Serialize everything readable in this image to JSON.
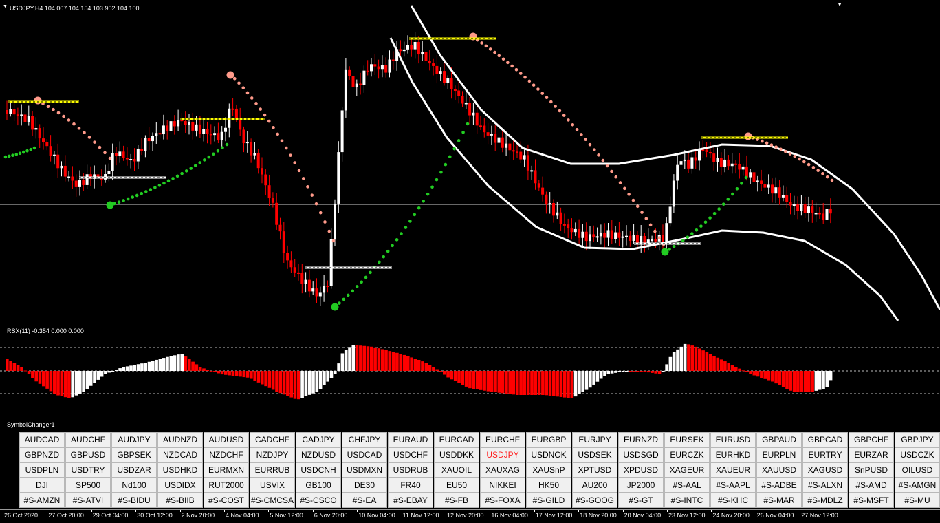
{
  "main": {
    "header": "USDJPY,H4  104.007 104.154 103.902 104.100"
  },
  "oscillator": {
    "header": "RSX(11) -0.354 0.000 0.000"
  },
  "symbol_changer": {
    "title": "SymbolChanger1",
    "active": "USDJPY",
    "rows": [
      [
        "AUDCAD",
        "AUDCHF",
        "AUDJPY",
        "AUDNZD",
        "AUDUSD",
        "CADCHF",
        "CADJPY",
        "CHFJPY",
        "EURAUD",
        "EURCAD",
        "EURCHF",
        "EURGBP",
        "EURJPY",
        "EURNZD",
        "EURSEK",
        "EURUSD",
        "GBPAUD",
        "GBPCAD",
        "GBPCHF",
        "GBPJPY"
      ],
      [
        "GBPNZD",
        "GBPUSD",
        "GBPSEK",
        "NZDCAD",
        "NZDCHF",
        "NZDJPY",
        "NZDUSD",
        "USDCAD",
        "USDCHF",
        "USDDKK",
        "USDJPY",
        "USDNOK",
        "USDSEK",
        "USDSGD",
        "EURCZK",
        "EURHKD",
        "EURPLN",
        "EURTRY",
        "EURZAR",
        "USDCZK"
      ],
      [
        "USDPLN",
        "USDTRY",
        "USDZAR",
        "USDHKD",
        "EURMXN",
        "EURRUB",
        "USDCNH",
        "USDMXN",
        "USDRUB",
        "XAUOIL",
        "XAUXAG",
        "XAUSnP",
        "XPTUSD",
        "XPDUSD",
        "XAGEUR",
        "XAUEUR",
        "XAUUSD",
        "XAGUSD",
        "SnPUSD",
        "OILUSD"
      ],
      [
        "DJI",
        "SP500",
        "Nd100",
        "USDIDX",
        "RUT2000",
        "USVIX",
        "GB100",
        "DE30",
        "FR40",
        "EU50",
        "NIKKEI",
        "HK50",
        "AU200",
        "JP2000",
        "#S-AAL",
        "#S-AAPL",
        "#S-ADBE",
        "#S-ALXN",
        "#S-AMD",
        "#S-AMGN"
      ],
      [
        "#S-AMZN",
        "#S-ATVI",
        "#S-BIDU",
        "#S-BIIB",
        "#S-COST",
        "#S-CMCSA",
        "#S-CSCO",
        "#S-EA",
        "#S-EBAY",
        "#S-FB",
        "#S-FOXA",
        "#S-GILD",
        "#S-GOOG",
        "#S-GT",
        "#S-INTC",
        "#S-KHC",
        "#S-MAR",
        "#S-MDLZ",
        "#S-MSFT",
        "#S-MU"
      ]
    ]
  },
  "time_axis": {
    "labels": [
      "26 Oct 2020",
      "27 Oct 20:00",
      "29 Oct 04:00",
      "30 Oct 12:00",
      "2 Nov 20:00",
      "4 Nov 04:00",
      "5 Nov 12:00",
      "6 Nov 20:00",
      "10 Nov 04:00",
      "11 Nov 12:00",
      "12 Nov 20:00",
      "16 Nov 04:00",
      "17 Nov 12:00",
      "18 Nov 20:00",
      "20 Nov 04:00",
      "23 Nov 12:00",
      "24 Nov 20:00",
      "26 Nov 04:00",
      "27 Nov 12:00"
    ]
  },
  "colors": {
    "bull": "#ffffff",
    "bear": "#ff0000",
    "sar_up": "#22cc22",
    "sar_down": "#ff9a8a",
    "level": "#ffff00",
    "channel": "#ffffff"
  }
}
